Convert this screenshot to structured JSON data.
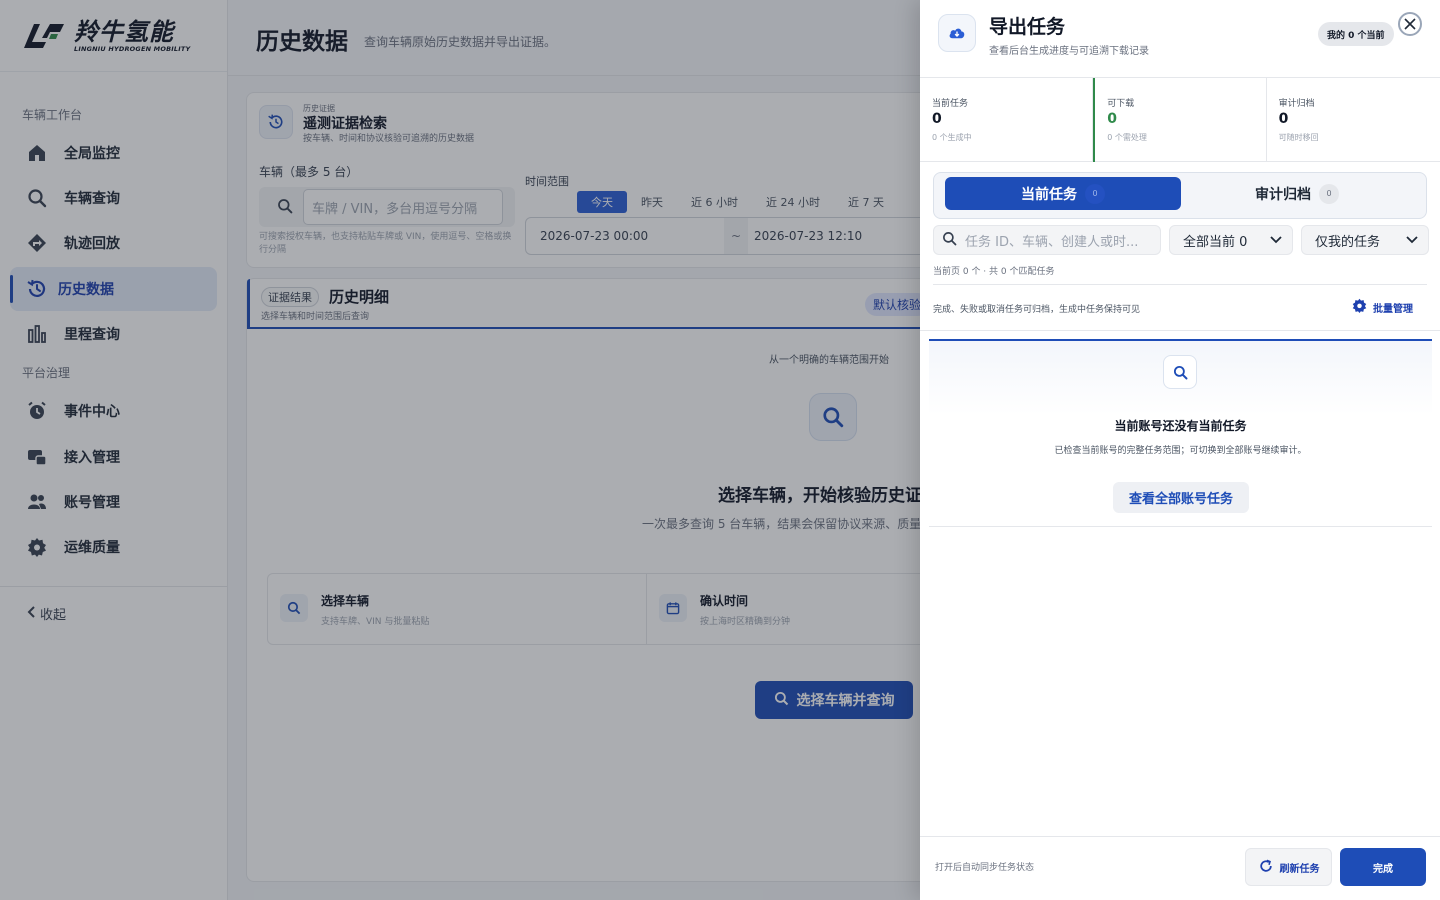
{
  "brand": {
    "name_cn": "羚牛氢能",
    "name_en": "LINGNIU HYDROGEN MOBILITY"
  },
  "sidebar": {
    "section1": "车辆工作台",
    "section2": "平台治理",
    "items": [
      {
        "label": "全局监控",
        "icon": "home-icon"
      },
      {
        "label": "车辆查询",
        "icon": "search-icon"
      },
      {
        "label": "轨迹回放",
        "icon": "route-icon"
      },
      {
        "label": "历史数据",
        "icon": "history-icon",
        "active": true
      },
      {
        "label": "里程查询",
        "icon": "bar-chart-icon"
      },
      {
        "label": "事件中心",
        "icon": "alarm-icon"
      },
      {
        "label": "接入管理",
        "icon": "device-icon"
      },
      {
        "label": "账号管理",
        "icon": "users-icon"
      },
      {
        "label": "运维质量",
        "icon": "gear-icon"
      }
    ],
    "collapse": "收起"
  },
  "page": {
    "title": "历史数据",
    "subtitle": "查询车辆原始历史数据并导出证据。"
  },
  "search_card": {
    "kicker": "历史证据",
    "title": "遥测证据检索",
    "desc": "按车辆、时间和协议核验可追溯的历史数据",
    "vehicle_label": "车辆（最多 5 台）",
    "vehicle_placeholder": "车牌 / VIN，多台用逗号分隔",
    "vehicle_help": "可搜索授权车辆，也支持粘贴车牌或 VIN，使用逗号、空格或换行分隔",
    "time_label": "时间范围",
    "ranges": [
      "今天",
      "昨天",
      "近 6 小时",
      "近 24 小时",
      "近 7 天"
    ],
    "start": "2026-07-23 00:00",
    "sep": "~",
    "end": "2026-07-23 12:10"
  },
  "result_card": {
    "tag": "证据结果",
    "title": "历史明细",
    "sub": "选择车辆和时间范围后查询",
    "pill": "默认核验",
    "hint": "从一个明确的车辆范围开始",
    "big": "选择车辆，开始核验历史证",
    "small": "一次最多查询 5 台车辆，结果会保留协议来源、质量",
    "step1_title": "选择车辆",
    "step1_desc": "支持车牌、VIN 与批量粘贴",
    "step2_title": "确认时间",
    "step2_desc": "按上海时区精确到分钟",
    "cta": "选择车辆并查询"
  },
  "drawer": {
    "title": "导出任务",
    "subtitle": "查看后台生成进度与可追溯下载记录",
    "badge": "我的 0 个当前",
    "stats": [
      {
        "label": "当前任务",
        "value": "0",
        "sub": "0 个生成中"
      },
      {
        "label": "可下载",
        "value": "0",
        "sub": "0 个需处理"
      },
      {
        "label": "审计归档",
        "value": "0",
        "sub": "可随时移回"
      }
    ],
    "tab_current": "当前任务",
    "tab_current_count": "0",
    "tab_archive": "审计归档",
    "tab_archive_count": "0",
    "search_placeholder": "任务 ID、车辆、创建人或时...",
    "filter_status": "全部当前 0",
    "filter_owner": "仅我的任务",
    "page_info": "当前页 0 个 · 共 0 个匹配任务",
    "archive_note": "完成、失败或取消任务可归档，生成中任务保持可见",
    "batch": "批量管理",
    "empty_title": "当前账号还没有当前任务",
    "empty_desc": "已检查当前账号的完整任务范围；可切换到全部账号继续审计。",
    "empty_btn": "查看全部账号任务",
    "foot_note": "打开后自动同步任务状态",
    "refresh": "刷新任务",
    "done": "完成"
  },
  "colors": {
    "primary": "#1e4db7",
    "success": "#2f8a4a",
    "overlay": "rgba(35,40,50,0.38)"
  }
}
